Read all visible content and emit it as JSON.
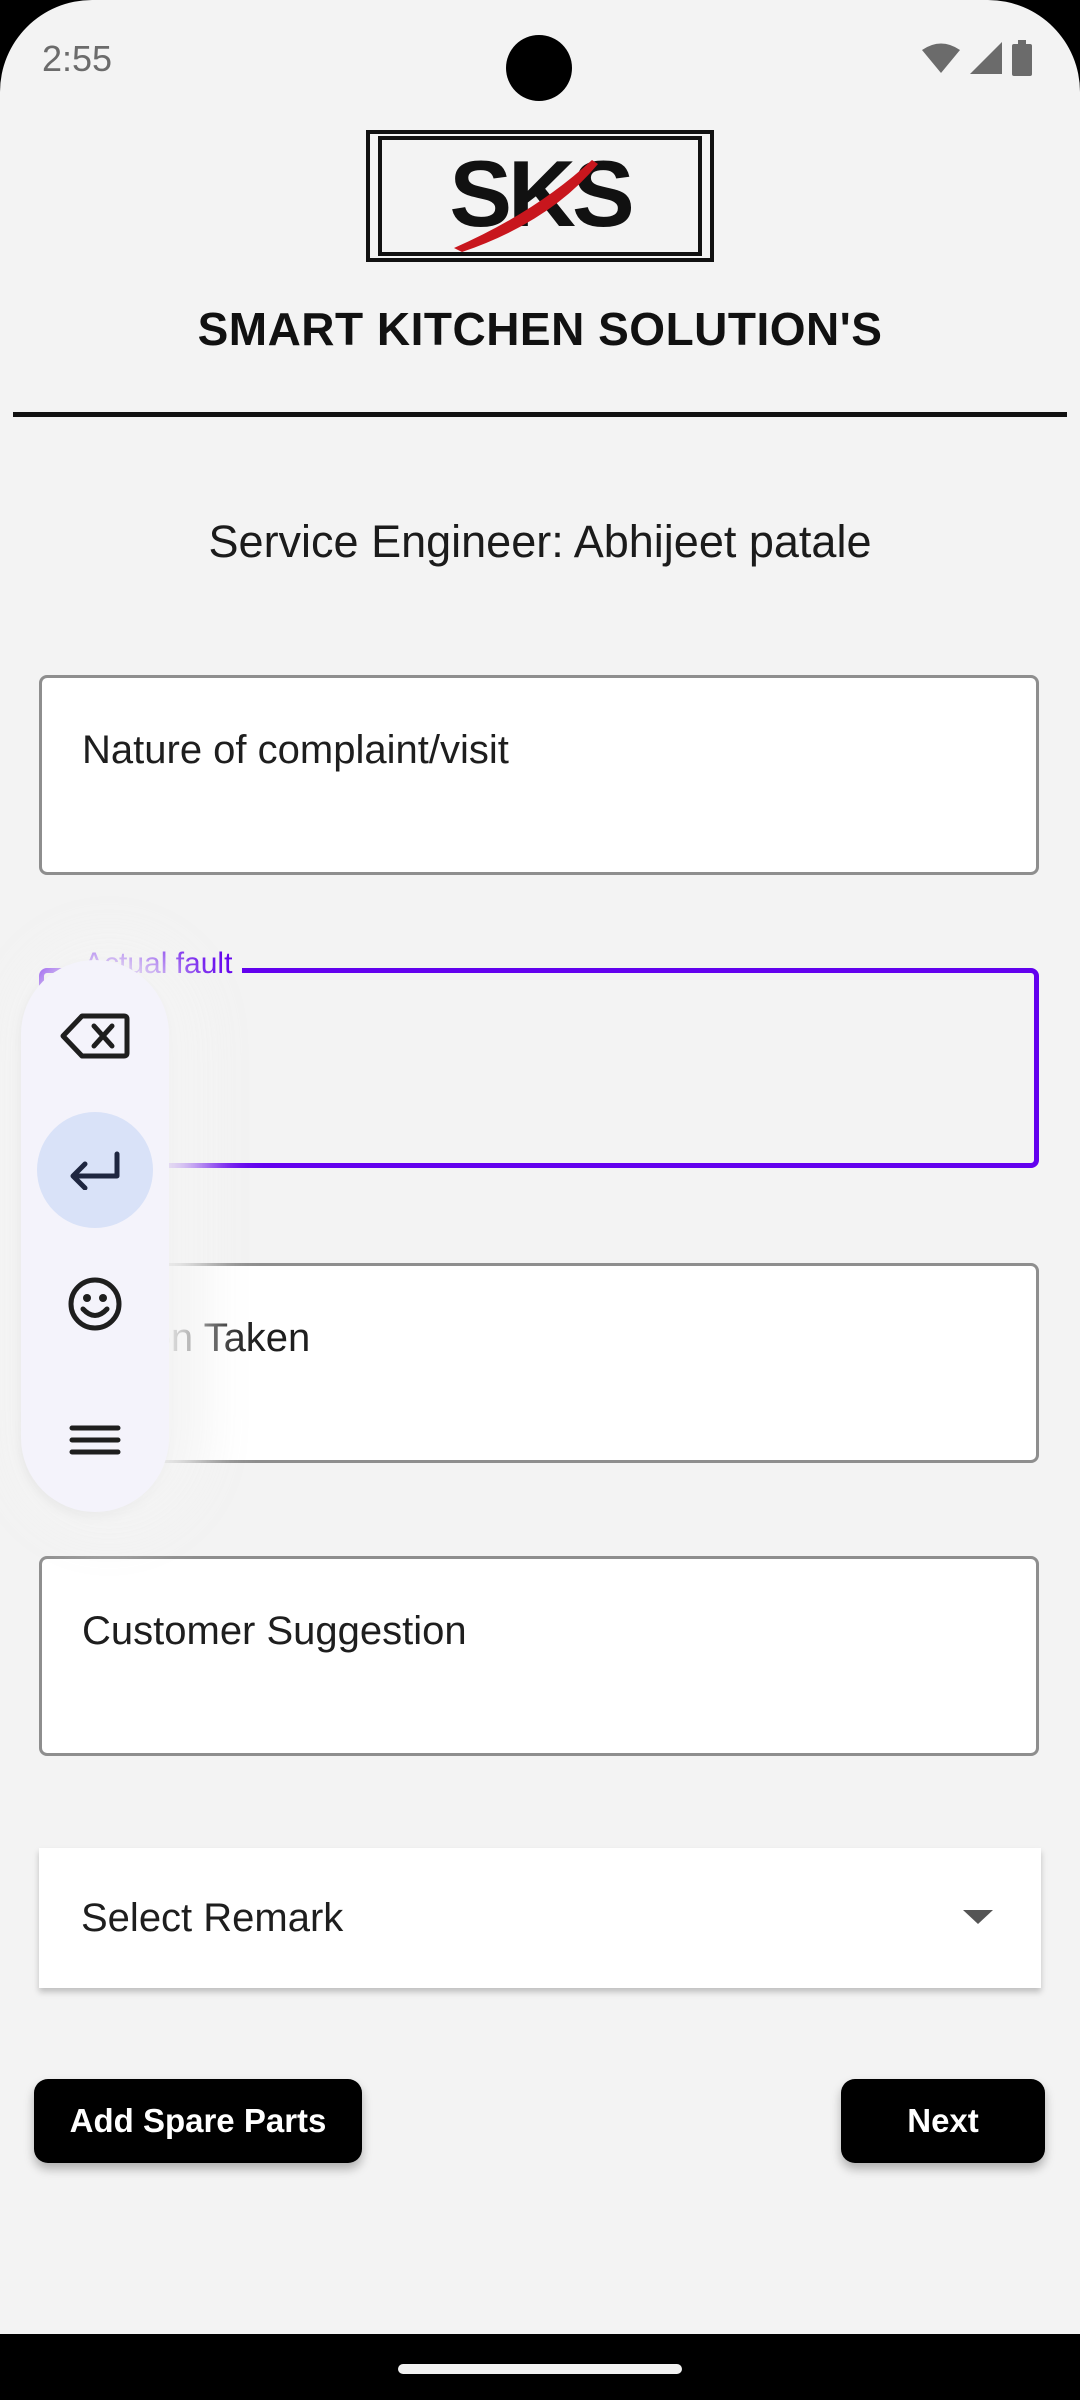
{
  "status_bar": {
    "time": "2:55",
    "icons": [
      "wifi-icon",
      "signal-icon",
      "battery-icon"
    ]
  },
  "logo": {
    "text": "SKS",
    "accent_color": "#c8161d"
  },
  "header": {
    "title": "SMART KITCHEN SOLUTION'S"
  },
  "engineer": {
    "text": "Service Engineer: Abhijeet patale"
  },
  "form": {
    "nature_label": "Nature of complaint/visit",
    "actual_fault_label": "Actual fault",
    "action_taken_label": "Action Taken",
    "customer_suggestion_label": "Customer Suggestion",
    "remark_select_label": "Select Remark"
  },
  "buttons": {
    "add_spare_parts": "Add Spare Parts",
    "next": "Next"
  },
  "keyboard_toolbar": {
    "items": [
      "backspace-icon",
      "enter-icon",
      "emoji-icon",
      "menu-icon"
    ]
  },
  "colors": {
    "accent": "#6200ee",
    "background": "#f3f3f3",
    "button": "#000000"
  }
}
